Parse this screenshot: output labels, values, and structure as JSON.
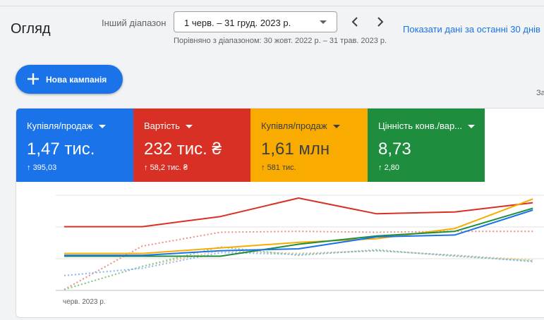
{
  "header": {
    "title": "Огляд",
    "range_label": "Інший діапазон",
    "range_value": "1 черв. – 31 груд. 2023 р.",
    "compare_text": "Порівняно з діапазоном: 30 жовт. 2022 р. – 31 трав. 2023 р.",
    "show_last_link": "Показати дані за останні 30 днів"
  },
  "actions": {
    "new_campaign_label": "Нова кампанія",
    "side_text": "За"
  },
  "metrics": [
    {
      "label": "Купівля/продаж",
      "value": "1,47 тис.",
      "delta": "395,03",
      "color": "#1a73e8"
    },
    {
      "label": "Вартість",
      "value": "232 тис. ₴",
      "delta": "58,2 тис. ₴",
      "color": "#d93025"
    },
    {
      "label": "Купівля/продаж",
      "value": "1,61 млн",
      "delta": "581 тис.",
      "color": "#f9ab00"
    },
    {
      "label": "Цінність конв./вар...",
      "value": "8,73",
      "delta": "2,80",
      "color": "#1e8e3e"
    }
  ],
  "chart_data": {
    "type": "line",
    "x_tick_labels": [
      "черв. 2023 р."
    ],
    "x_index": [
      0,
      1,
      2,
      3,
      4,
      5,
      6
    ],
    "ylim": [
      0,
      100
    ],
    "grid": true,
    "series": [
      {
        "color": "#d93025",
        "style": "solid",
        "values": [
          69,
          69,
          80,
          100,
          83,
          85,
          95
        ]
      },
      {
        "color": "#f9ab00",
        "style": "solid",
        "values": [
          40,
          40,
          46,
          52,
          56,
          67,
          99
        ]
      },
      {
        "color": "#1e8e3e",
        "style": "solid",
        "values": [
          37,
          37,
          37,
          50,
          59,
          64,
          89
        ]
      },
      {
        "color": "#1a73e8",
        "style": "solid",
        "values": [
          38,
          38,
          43,
          45,
          58,
          60,
          87
        ]
      },
      {
        "color": "#e88f85",
        "style": "dotted",
        "values": [
          1,
          48,
          63,
          64,
          63,
          64,
          64
        ]
      },
      {
        "color": "#f7c36b",
        "style": "dotted",
        "values": [
          1,
          26,
          43,
          40,
          43,
          38,
          33
        ]
      },
      {
        "color": "#81c995",
        "style": "dotted",
        "values": [
          1,
          26,
          47,
          38,
          44,
          37,
          32
        ]
      },
      {
        "color": "#8ab4f8",
        "style": "dotted",
        "values": [
          16,
          24,
          41,
          39,
          43,
          38,
          31
        ]
      }
    ]
  }
}
